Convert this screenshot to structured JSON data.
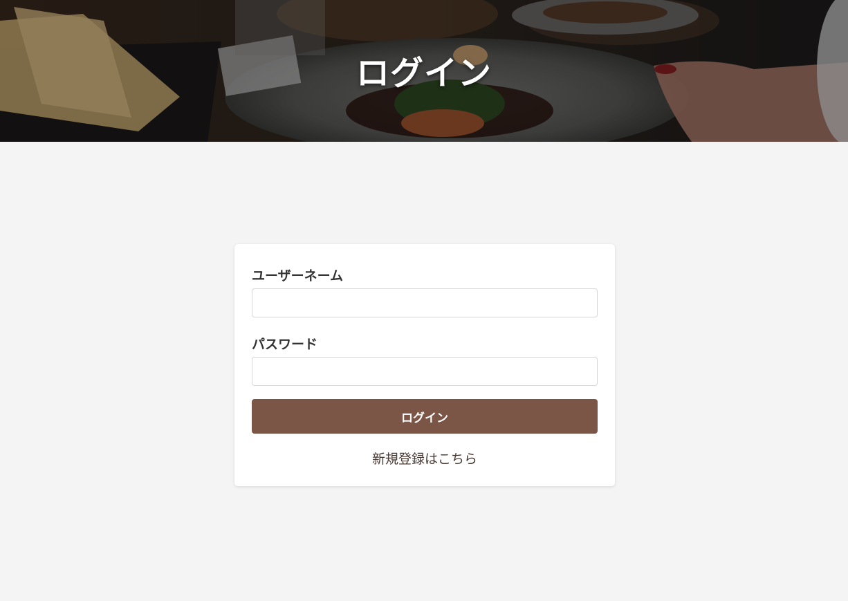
{
  "header": {
    "title": "ログイン"
  },
  "login_form": {
    "username_label": "ユーザーネーム",
    "username_value": "",
    "password_label": "パスワード",
    "password_value": "",
    "submit_label": "ログイン",
    "register_link": "新規登録はこちら"
  },
  "colors": {
    "page_background": "#f4f4f4",
    "button": "#7b5545",
    "link_text": "#4a3a34"
  }
}
